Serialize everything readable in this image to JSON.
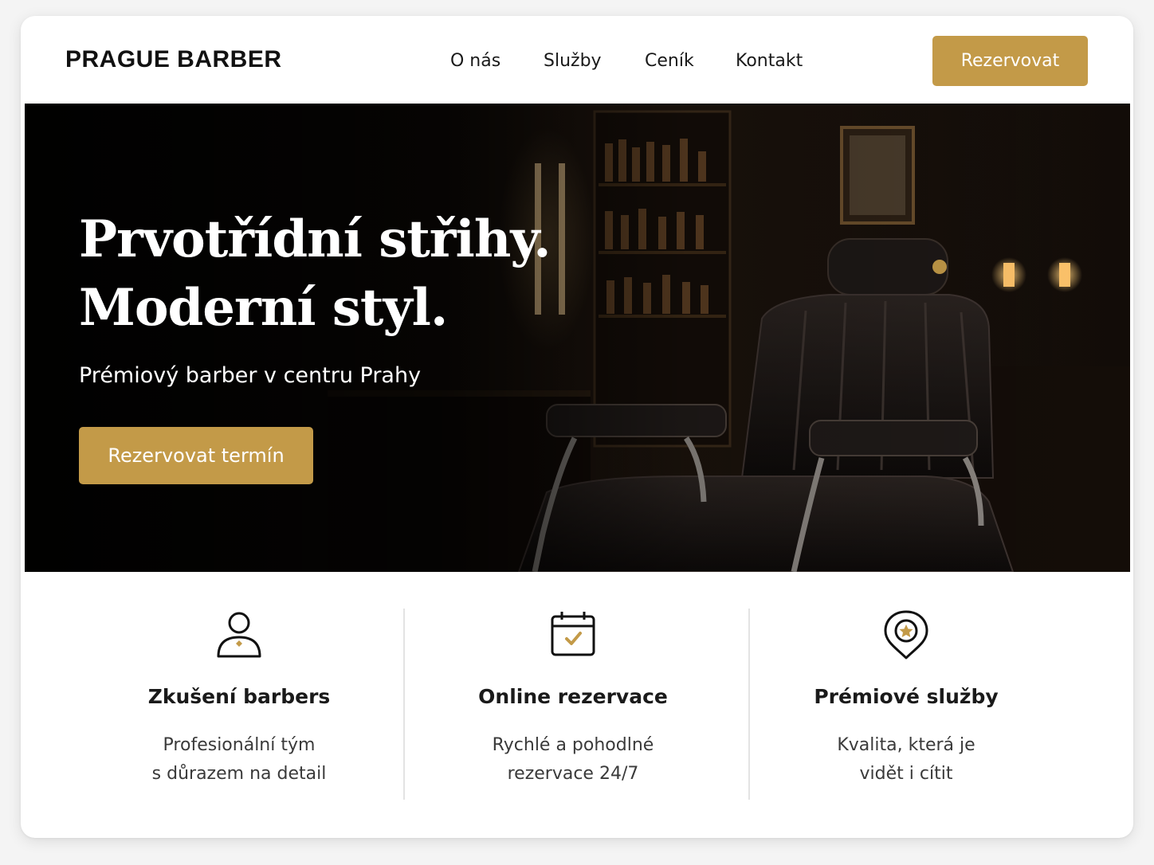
{
  "header": {
    "logo": "PRAGUE BARBER",
    "nav": [
      "O nás",
      "Služby",
      "Ceník",
      "Kontakt"
    ],
    "cta": "Rezervovat"
  },
  "hero": {
    "title_line1": "Prvotřídní střihy.",
    "title_line2": "Moderní styl.",
    "subtitle": "Prémiový barber v centru Prahy",
    "cta": "Rezervovat termín"
  },
  "features": [
    {
      "icon": "barber-person-icon",
      "title": "Zkušení barbers",
      "line1": "Profesionální tým",
      "line2": "s důrazem na detail"
    },
    {
      "icon": "calendar-check-icon",
      "title": "Online rezervace",
      "line1": "Rychlé a pohodlné",
      "line2": "rezervace 24/7"
    },
    {
      "icon": "premium-badge-icon",
      "title": "Prémiové služby",
      "line1": "Kvalita, která je",
      "line2": "vidět i cítit"
    }
  ],
  "colors": {
    "accent": "#c39a48",
    "hero_bg": "#0b0806",
    "text": "#1a1a1a"
  }
}
